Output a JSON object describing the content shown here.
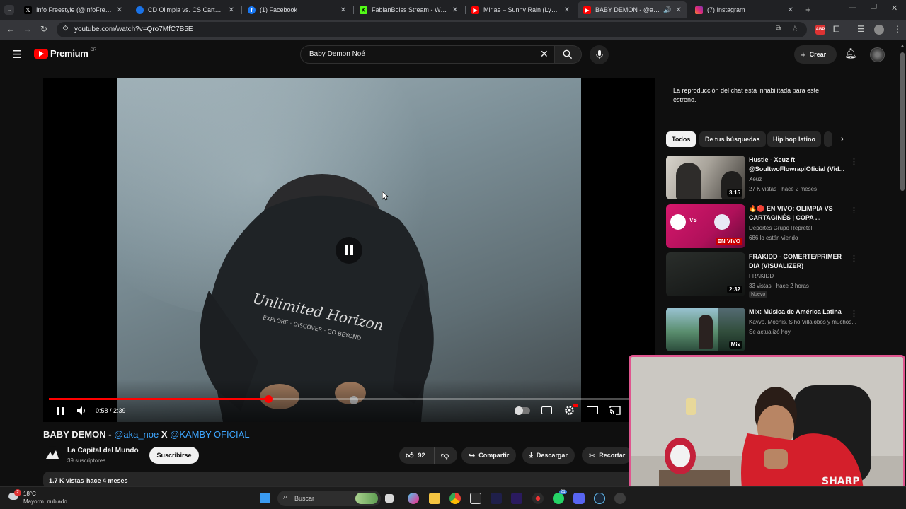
{
  "browser": {
    "tabs": [
      {
        "title": "Info Freestyle (@InfoFreestyle2..."
      },
      {
        "title": "CD Olimpia vs. CS Cartaginés (C..."
      },
      {
        "title": "(1) Facebook"
      },
      {
        "title": "FabianBolss Stream - Watch Liv..."
      },
      {
        "title": "Miriae – Sunny Rain (Lyrics vid..."
      },
      {
        "title": "BABY DEMON - @aka_noe"
      },
      {
        "title": "(7) Instagram"
      }
    ],
    "url": "youtube.com/watch?v=Qro7MfC7B5E"
  },
  "youtube": {
    "logo": "Premium",
    "country": "CR",
    "search_value": "Baby Demon Noé",
    "create_label": "Crear"
  },
  "player": {
    "time": "0:58 / 2:39",
    "progress": 0.365,
    "state": "playing"
  },
  "video": {
    "title_prefix": "BABY DEMON - ",
    "mention1": "@aka_noe",
    "x_sep": " X ",
    "mention2": "@KAMBY-OFICIAL",
    "channel": "La Capital del Mundo",
    "subscribers": "39 suscriptores",
    "subscribe_label": "Suscribirse",
    "likes": "92",
    "share_label": "Compartir",
    "download_label": "Descargar",
    "clip_label": "Recortar",
    "views": "1.7 K vistas",
    "date": "hace 4 meses"
  },
  "sidebar": {
    "chat_notice": "La reproducción del chat está inhabilitada para este estreno.",
    "chips": [
      "Todos",
      "De tus búsquedas",
      "Hip hop latino"
    ],
    "recs": [
      {
        "title": "Hustle - Xeuz ft @SoultwoFlowrapiOficial (Vid...",
        "channel": "Xeuz",
        "meta": "27 K vistas · hace 2 meses",
        "duration": "3:15",
        "badge": ""
      },
      {
        "title": "🔥🔴 EN VIVO: OLIMPIA VS CARTAGINÉS | COPA ...",
        "channel": "Deportes Grupo Repretel",
        "meta": "686 lo están viendo",
        "duration": "EN VIVO",
        "badge": ""
      },
      {
        "title": "FRAKIDD - COMERTE/PRIMER DIA (VISUALIZER)",
        "channel": "FRAKIDD",
        "meta": "33 vistas · hace 2 horas",
        "duration": "2:32",
        "badge": "Nuevo"
      },
      {
        "title": "Mix: Música de América Latina",
        "channel": "Kavvo, Mochis, Siho Villalobos y muchos...",
        "meta": "Se actualizó hoy",
        "duration": "Mix",
        "badge": ""
      }
    ]
  },
  "taskbar": {
    "weather_temp": "18°C",
    "weather_desc": "Mayorm. nublado",
    "weather_badge": "2",
    "search_placeholder": "Buscar",
    "badge_count": "21"
  },
  "colors": {
    "accent": "#ff0000",
    "link": "#3ea6ff",
    "cam_border": "#e0558e"
  }
}
